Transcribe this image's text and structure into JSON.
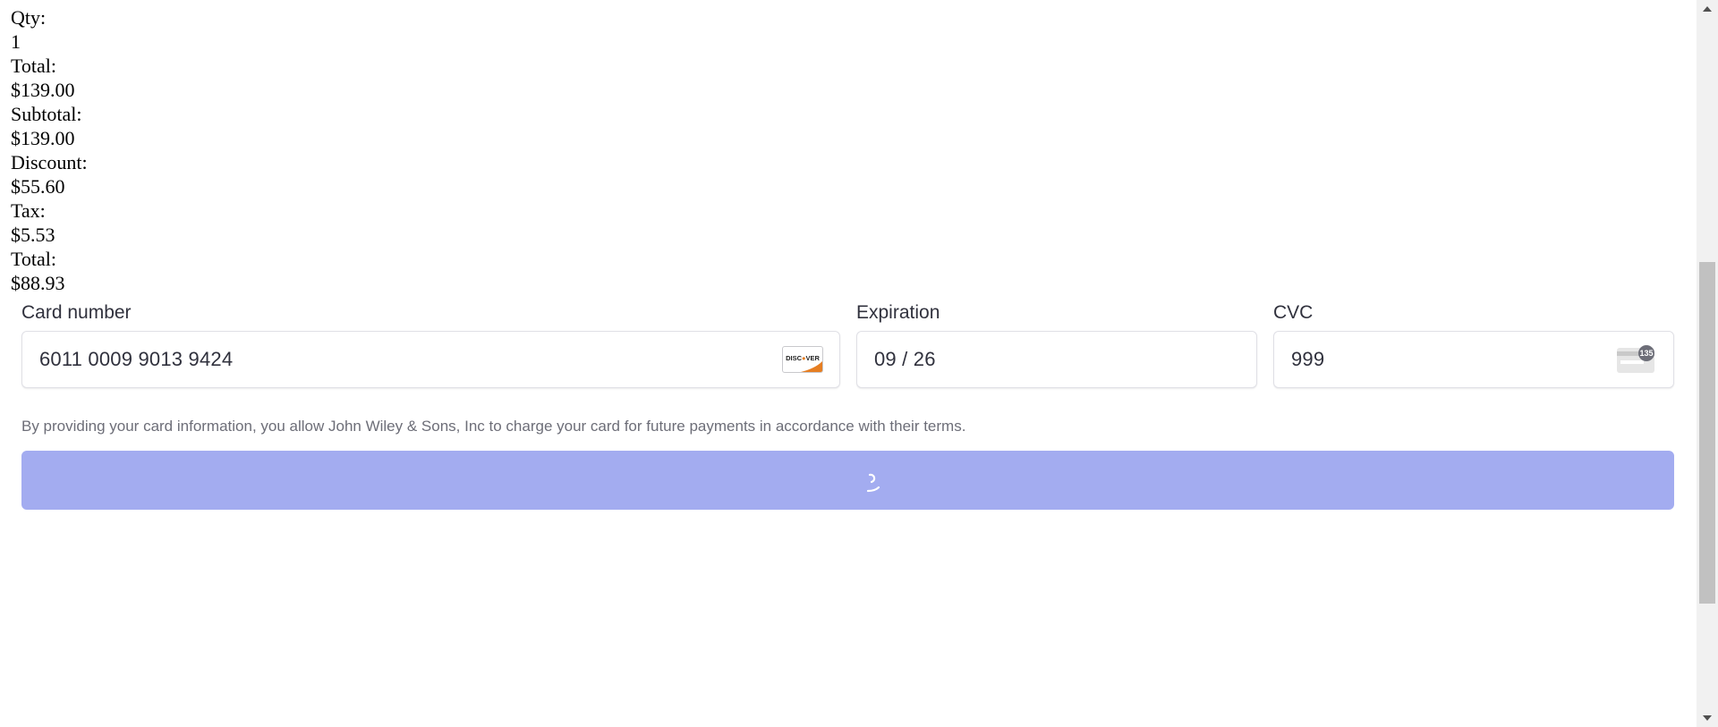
{
  "summary": {
    "qty_label": "Qty:",
    "qty_value": "1",
    "total_label": "Total:",
    "total_value": "$139.00",
    "subtotal_label": "Subtotal:",
    "subtotal_value": "$139.00",
    "discount_label": "Discount:",
    "discount_value": "$55.60",
    "tax_label": "Tax:",
    "tax_value": "$5.53",
    "grand_total_label": "Total:",
    "grand_total_value": "$88.93"
  },
  "payment": {
    "card_number": {
      "label": "Card number",
      "value": "6011 0009 9013 9424",
      "brand_icon": "discover-card-icon",
      "brand_text": "DISCOVER"
    },
    "expiration": {
      "label": "Expiration",
      "value": "09 / 26"
    },
    "cvc": {
      "label": "CVC",
      "value": "999",
      "icon": "cvc-card-icon",
      "icon_text": "135"
    },
    "terms": "By providing your card information, you allow John Wiley & Sons, Inc to charge your card for future payments in accordance with their terms.",
    "pay_button": {
      "state": "loading",
      "icon": "spinner-icon"
    }
  },
  "colors": {
    "button": "#a3acf0",
    "text": "#30313d",
    "muted_text": "#6d6e78",
    "discover_orange": "#e67e22"
  }
}
